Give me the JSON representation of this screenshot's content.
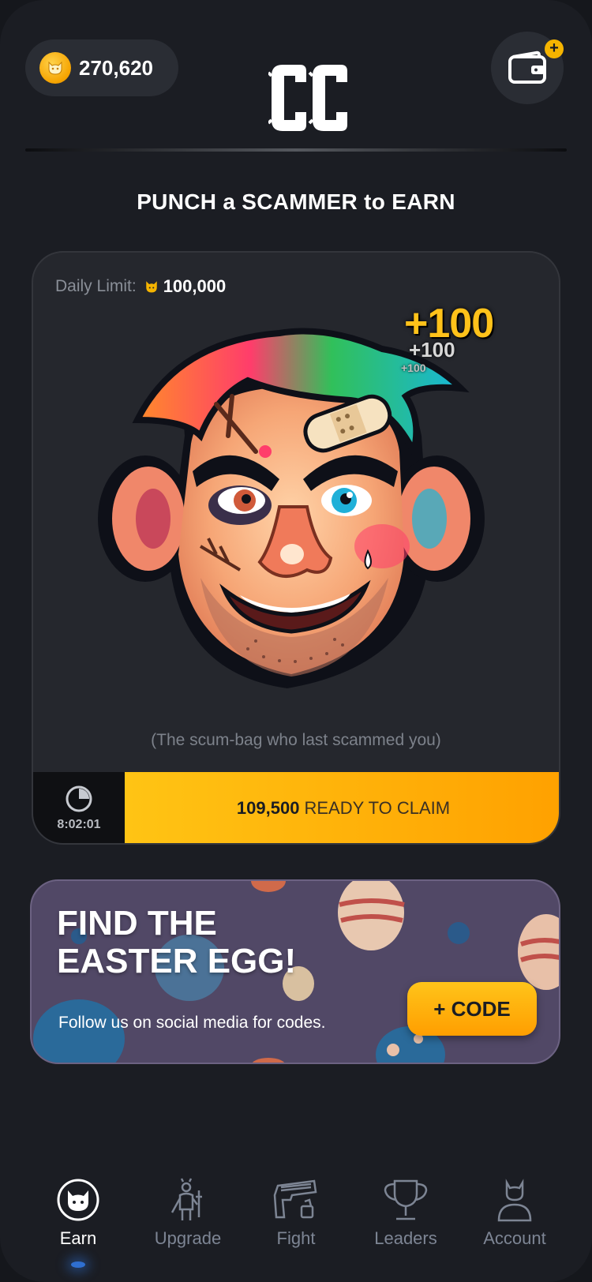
{
  "header": {
    "balance": "270,620",
    "logo_text": "CC",
    "wallet_badge": "+"
  },
  "tagline": "PUNCH a SCAMMER to EARN",
  "punch_card": {
    "daily_limit_label": "Daily Limit:",
    "daily_limit_value": "100,000",
    "popups": [
      "+100",
      "+100",
      "+100"
    ],
    "caption": "(The scum-bag who last scammed you)",
    "timer": "8:02:01",
    "claim_amount": "109,500",
    "claim_text": "READY TO CLAIM"
  },
  "promo": {
    "title_line1": "FIND THE",
    "title_line2": "EASTER EGG!",
    "subtitle": "Follow us on social media for codes.",
    "code_button": "+ CODE"
  },
  "nav": {
    "items": [
      {
        "label": "Earn",
        "icon": "cat-icon",
        "active": true
      },
      {
        "label": "Upgrade",
        "icon": "upgrade-figure-icon",
        "active": false
      },
      {
        "label": "Fight",
        "icon": "gun-icon",
        "active": false
      },
      {
        "label": "Leaders",
        "icon": "trophy-icon",
        "active": false
      },
      {
        "label": "Account",
        "icon": "user-icon",
        "active": false
      }
    ]
  },
  "colors": {
    "background": "#1b1d23",
    "card": "#25272d",
    "accent": "#ffb20a",
    "muted_text": "#7d8594",
    "promo_bg": "#514866",
    "active_glow": "#2f6fd0"
  }
}
